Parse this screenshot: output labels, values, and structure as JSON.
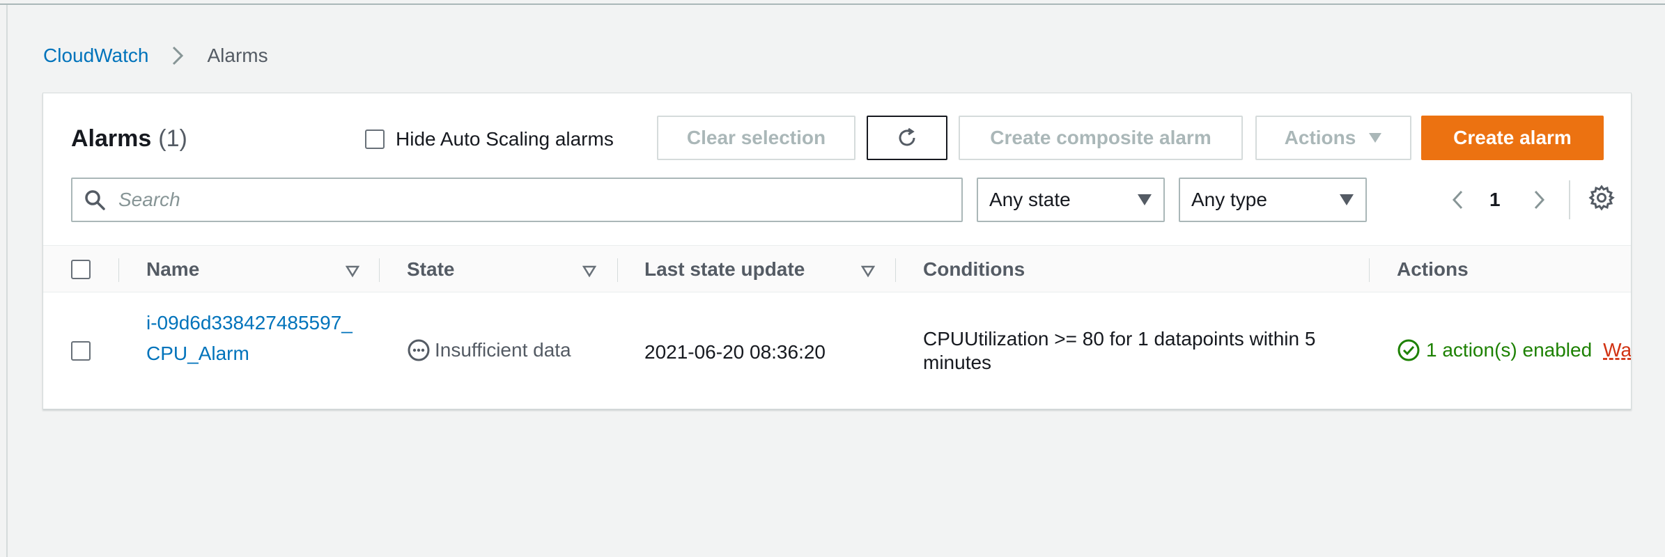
{
  "breadcrumb": {
    "root": "CloudWatch",
    "current": "Alarms"
  },
  "panel": {
    "title": "Alarms",
    "count": "(1)",
    "hide_autoscaling_label": "Hide Auto Scaling alarms",
    "buttons": {
      "clear": "Clear selection",
      "composite": "Create composite alarm",
      "actions": "Actions",
      "create": "Create alarm"
    },
    "search": {
      "placeholder": "Search",
      "value": ""
    },
    "filters": {
      "state": "Any state",
      "type": "Any type"
    },
    "pagination": {
      "page": "1"
    }
  },
  "table": {
    "columns": {
      "name": "Name",
      "state": "State",
      "last_update": "Last state update",
      "conditions": "Conditions",
      "actions": "Actions"
    },
    "rows": [
      {
        "name": "i-09d6d338427485597_CPU_Alarm",
        "state": "Insufficient data",
        "last_update": "2021-06-20 08:36:20",
        "conditions": "CPUUtilization >= 80 for 1 datapoints within 5 minutes",
        "actions": "1 action(s) enabled",
        "actions_warning": "Wa"
      }
    ]
  },
  "colors": {
    "link": "#0073bb",
    "primary": "#ec7211",
    "success": "#1d8102",
    "warning": "#d13212",
    "background": "#f2f3f3"
  },
  "icons": [
    "chevron-right-icon",
    "refresh-icon",
    "caret-down-icon",
    "search-icon",
    "chevron-left-icon",
    "settings-icon",
    "sort-icon",
    "insufficient-data-icon",
    "check-circle-icon"
  ]
}
